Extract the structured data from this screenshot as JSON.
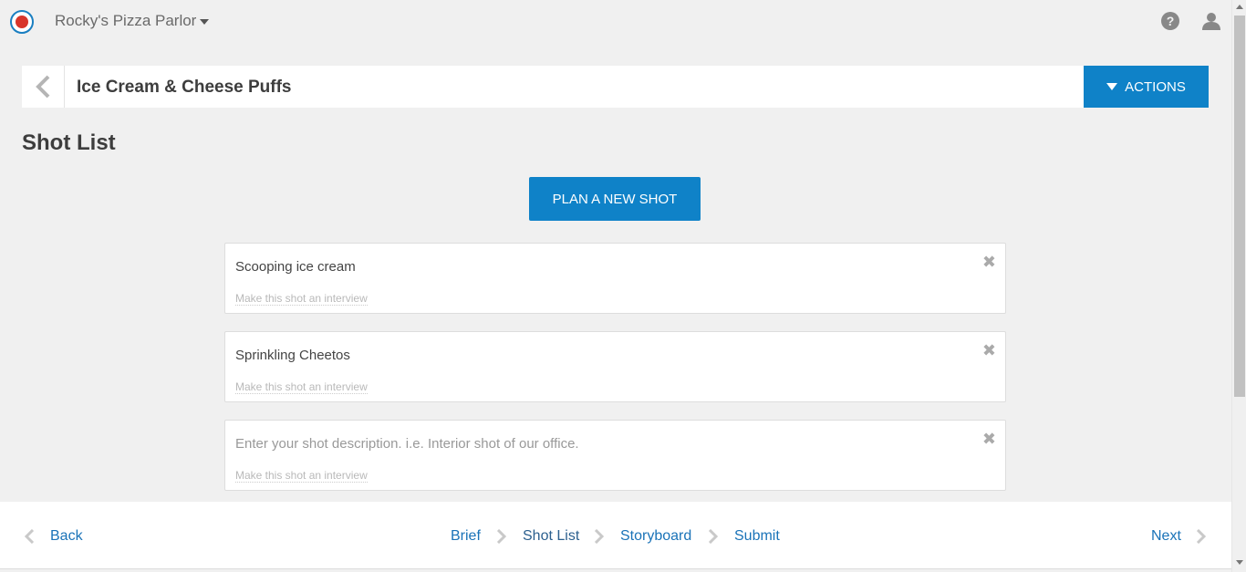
{
  "app": {
    "org_name": "Rocky's Pizza Parlor",
    "help_icon_glyph": "?"
  },
  "header": {
    "project_title": "Ice Cream & Cheese Puffs",
    "actions_label": "ACTIONS"
  },
  "main": {
    "page_title": "Shot List",
    "plan_button_label": "PLAN A NEW SHOT",
    "shots": [
      {
        "value": "Scooping ice cream",
        "placeholder": "",
        "interview_link": "Make this shot an interview"
      },
      {
        "value": "Sprinkling Cheetos",
        "placeholder": "",
        "interview_link": "Make this shot an interview"
      },
      {
        "value": "",
        "placeholder": "Enter your shot description. i.e. Interior shot of our office.",
        "interview_link": "Make this shot an interview"
      }
    ],
    "close_glyph": "✖"
  },
  "footer": {
    "back_label": "Back",
    "next_label": "Next",
    "steps": [
      "Brief",
      "Shot List",
      "Storyboard",
      "Submit"
    ],
    "current_step": "Shot List"
  },
  "colors": {
    "accent": "#0f82c8",
    "link": "#1a73b8",
    "background": "#f0f0f0"
  },
  "icons": [
    "logo-icon",
    "caret-down-icon",
    "help-icon",
    "user-icon",
    "chevron-left-icon",
    "close-icon",
    "chevron-right-icon"
  ]
}
